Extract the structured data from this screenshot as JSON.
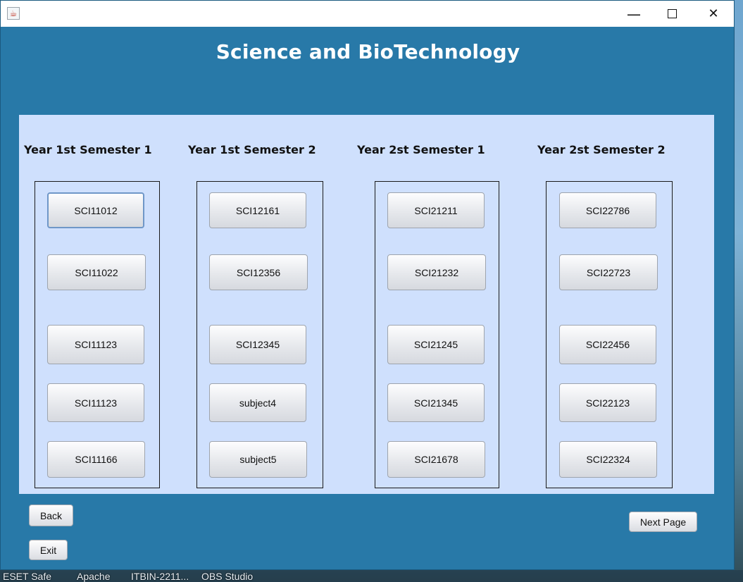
{
  "window": {
    "title": "",
    "controls": {
      "minimize": "—",
      "close": "✕"
    }
  },
  "app": {
    "title": "Science and BioTechnology"
  },
  "semesters": [
    {
      "label": "Year 1st Semester 1",
      "subjects": [
        "SCI11012",
        "SCI11022",
        "SCI11123",
        "SCI11123",
        "SCI11166"
      ]
    },
    {
      "label": "Year 1st Semester 2",
      "subjects": [
        "SCI12161",
        "SCI12356",
        "SCI12345",
        "subject4",
        "subject5"
      ]
    },
    {
      "label": "Year 2st Semester 1",
      "subjects": [
        "SCI21211",
        "SCI21232",
        "SCI21245",
        "SCI21345",
        "SCI21678"
      ]
    },
    {
      "label": "Year 2st Semester 2",
      "subjects": [
        "SCI22786",
        "SCI22723",
        "SCI22456",
        "SCI22123",
        "SCI22324"
      ]
    }
  ],
  "nav": {
    "back": "Back",
    "exit": "Exit",
    "next": "Next Page"
  },
  "taskbar": [
    "ESET Safe",
    "Apache",
    "ITBIN-2211...",
    "OBS Studio"
  ],
  "colors": {
    "window_bg": "#2879a8",
    "panel_bg": "#cfe0fd",
    "title_text": "#ffffff"
  }
}
